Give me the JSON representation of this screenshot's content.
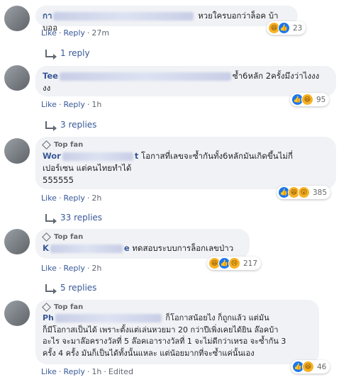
{
  "comments": [
    {
      "name": "กา",
      "top_fan": false,
      "text": "หวยใครบอกว่าล็อค บ้าบออ",
      "actions": {
        "like": "Like",
        "reply": "Reply",
        "time": "27m"
      },
      "reactions": {
        "icons": [
          "haha-icon",
          "like-icon"
        ],
        "count": "23"
      },
      "replies": "1 reply"
    },
    {
      "name": "Tee",
      "top_fan": false,
      "text": "ซ้ำ6หลัก 2ครั้งมึงว่าไงงง งง",
      "actions": {
        "like": "Like",
        "reply": "Reply",
        "time": "1h"
      },
      "reactions": {
        "icons": [
          "like-icon",
          "haha-icon"
        ],
        "count": "95"
      },
      "replies": "3 replies"
    },
    {
      "name": "Wor",
      "top_fan": true,
      "top_fan_label": "Top fan",
      "name_suffix": "t",
      "text_line1": "โอกาสที่เลขจะซ้ำกันทั้ง6หลักมันเกิดขึ้นไม่กี่",
      "text_line2": "เปอร์เซน แต่คนไทยทำได้",
      "text_line3": "555555",
      "actions": {
        "like": "Like",
        "reply": "Reply",
        "time": "2h"
      },
      "reactions": {
        "icons": [
          "like-icon",
          "haha-icon",
          "wow-icon"
        ],
        "count": "385"
      },
      "replies": "33 replies"
    },
    {
      "name": "K",
      "top_fan": true,
      "top_fan_label": "Top fan",
      "name_suffix": "e",
      "text": "ทดสอบระบบการล็อกเลขป่าว",
      "actions": {
        "like": "Like",
        "reply": "Reply",
        "time": "2h"
      },
      "reactions": {
        "icons": [
          "haha-icon",
          "like-icon",
          "sad-icon"
        ],
        "count": "217"
      },
      "replies": "5 replies"
    },
    {
      "name": "Ph",
      "top_fan": true,
      "top_fan_label": "Top fan",
      "text_line1": "ก็โอกาสน้อยไง ก็ถูกแล้ว แต่มัน",
      "text_line2": "ก็มีโอกาสเป็นได้ เพราะตั้งแต่เล่นหวยมา 20 กว่าปีเพิ่งเคยได้ยิน ล๊อคบ้า",
      "text_line3": "อะไร จะมาล๊อครางวัลที่ 5 ล๊อคเอารางวัลที่ 1 จะไม่ดีกว่าเหรอ จะซ้ำกัน 3",
      "text_line4": "ครั้ง 4 ครั้ง มันก็เป็นได้ทั้งนั้นแหละ แต่น้อยมากที่จะซ้ำแค่นั้นเอง",
      "actions": {
        "like": "Like",
        "reply": "Reply",
        "time": "1h",
        "edited": "Edited"
      },
      "reactions": {
        "icons": [
          "like-icon",
          "haha-icon"
        ],
        "count": "46"
      }
    }
  ],
  "dot": "·",
  "colors": {
    "link": "#385898",
    "bubble": "#f0f2f5",
    "like": "#1877f2",
    "emoji": "#f7b125"
  }
}
